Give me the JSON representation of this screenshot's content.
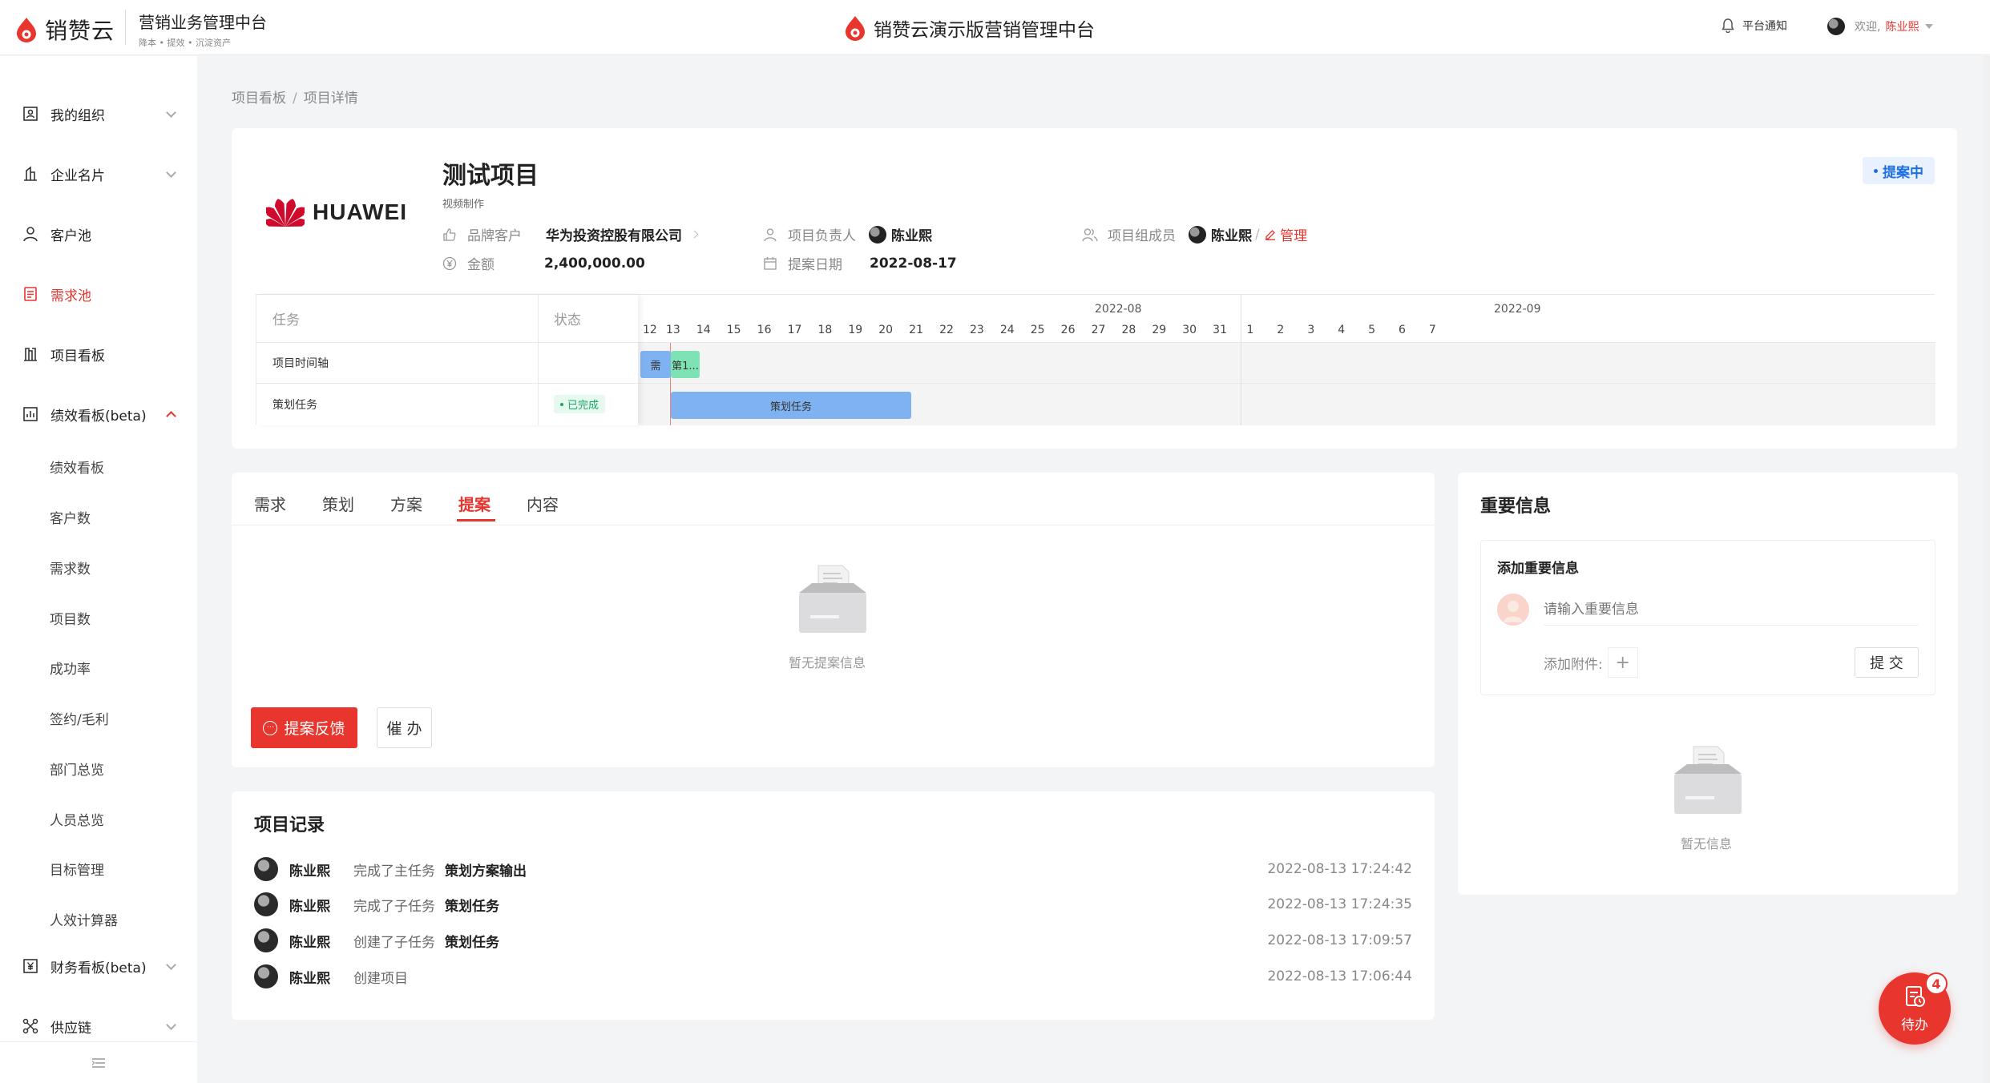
{
  "header": {
    "logo_text": "销赞云",
    "platform_title": "营销业务管理中台",
    "platform_sub": "降本 • 提效 • 沉淀资产",
    "center_title": "销赞云演示版营销管理中台",
    "notify_label": "平台通知",
    "welcome_label": "欢迎,",
    "user_name": "陈业熙"
  },
  "sidebar": {
    "items": [
      {
        "label": "我的组织",
        "icon": "org-icon"
      },
      {
        "label": "企业名片",
        "icon": "building-icon"
      },
      {
        "label": "客户池",
        "icon": "person-icon"
      },
      {
        "label": "需求池",
        "icon": "document-icon"
      },
      {
        "label": "项目看板",
        "icon": "board-icon"
      },
      {
        "label": "绩效看板(beta)",
        "icon": "chart-icon"
      },
      {
        "label": "财务看板(beta)",
        "icon": "yen-icon"
      },
      {
        "label": "供应链",
        "icon": "network-icon"
      }
    ],
    "sub_items": [
      "绩效看板",
      "客户数",
      "需求数",
      "项目数",
      "成功率",
      "签约/毛利",
      "部门总览",
      "人员总览",
      "目标管理",
      "人效计算器"
    ],
    "collapse_icon": "menu-collapse-icon"
  },
  "breadcrumb": {
    "parent": "项目看板",
    "separator": "/",
    "current": "项目详情"
  },
  "project": {
    "brand_logo_text": "HUAWEI",
    "title": "测试项目",
    "subtitle": "视频制作",
    "status": "提案中",
    "brand_customer_label": "品牌客户",
    "brand_customer_value": "华为投资控股有限公司",
    "amount_label": "金额",
    "amount_value": "2,400,000.00",
    "owner_label": "项目负责人",
    "owner_value": "陈业熙",
    "proposal_date_label": "提案日期",
    "proposal_date_value": "2022-08-17",
    "members_label": "项目组成员",
    "members_value": "陈业熙",
    "members_sep": "/",
    "manage_label": "管理"
  },
  "gantt": {
    "col_task": "任务",
    "col_status": "状态",
    "rows": [
      {
        "task": "项目时间轴",
        "status": ""
      },
      {
        "task": "策划任务",
        "status": "已完成"
      }
    ],
    "months": [
      "2022-08",
      "2022-09"
    ],
    "days_aug": [
      "12",
      "13",
      "14",
      "15",
      "16",
      "17",
      "18",
      "19",
      "20",
      "21",
      "22",
      "23",
      "24",
      "25",
      "26",
      "27",
      "28",
      "29",
      "30",
      "31"
    ],
    "days_sep": [
      "1",
      "2",
      "3",
      "4",
      "5",
      "6",
      "7"
    ],
    "bars": [
      {
        "label": "需",
        "color": "#7fb2f0"
      },
      {
        "label": "第1...",
        "color": "#7ee3b4"
      },
      {
        "label": "策划任务",
        "color": "#7fb2f0"
      }
    ]
  },
  "tabs": {
    "items": [
      "需求",
      "策划",
      "方案",
      "提案",
      "内容"
    ],
    "active_index": 3,
    "empty_text": "暂无提案信息",
    "feedback_button": "提案反馈",
    "urge_button": "催 办"
  },
  "records": {
    "title": "项目记录",
    "items": [
      {
        "user": "陈业熙",
        "action": "完成了主任务",
        "object": "策划方案输出",
        "time": "2022-08-13 17:24:42"
      },
      {
        "user": "陈业熙",
        "action": "完成了子任务",
        "object": "策划任务",
        "time": "2022-08-13 17:24:35"
      },
      {
        "user": "陈业熙",
        "action": "创建了子任务",
        "object": "策划任务",
        "time": "2022-08-13 17:09:57"
      },
      {
        "user": "陈业熙",
        "action": "创建项目",
        "object": "",
        "time": "2022-08-13 17:06:44"
      }
    ]
  },
  "important_info": {
    "title": "重要信息",
    "add_title": "添加重要信息",
    "input_placeholder": "请输入重要信息",
    "attach_label": "添加附件:",
    "submit_label": "提 交",
    "empty_text": "暂无信息"
  },
  "todo": {
    "label": "待办",
    "count": "4"
  },
  "colors": {
    "accent": "#e8352e",
    "status_blue": "#1e6fe0",
    "done_green": "#1aa564"
  }
}
